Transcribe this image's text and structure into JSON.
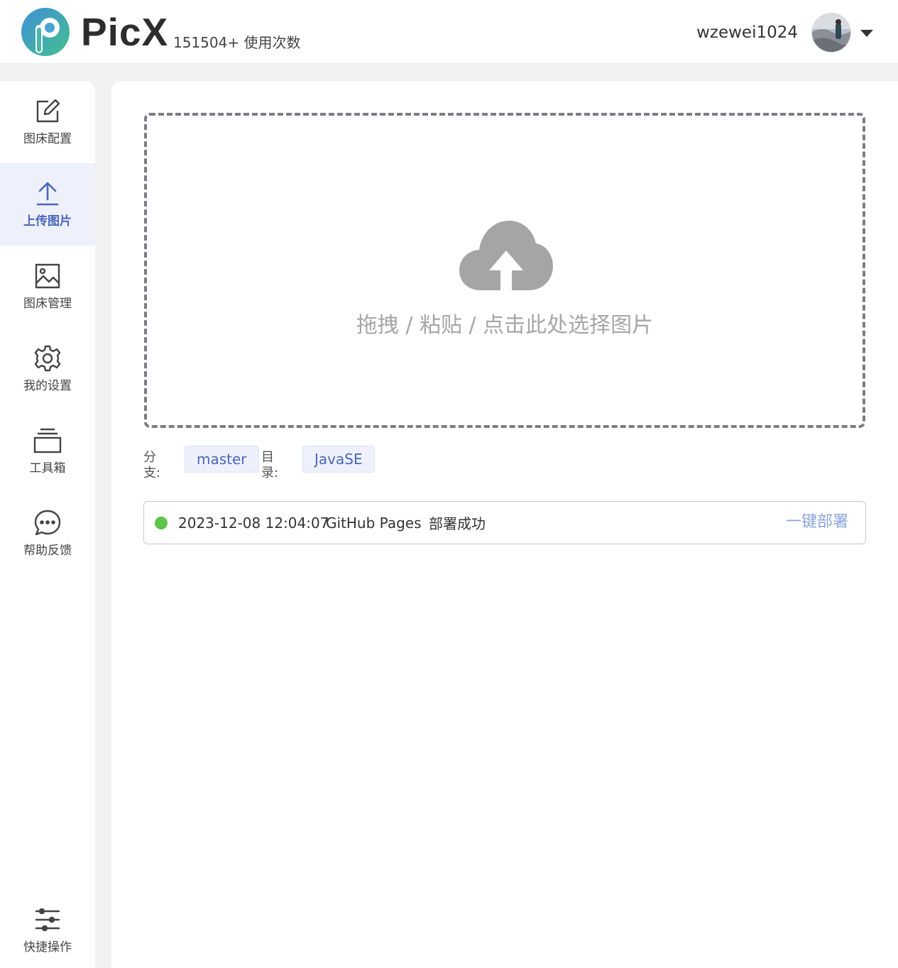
{
  "header": {
    "brand": "PicX",
    "usage": "151504+ 使用次数",
    "username": "wzewei1024",
    "logo_icon": "picx-logo-icon",
    "dropdown_icon": "caret-down-icon"
  },
  "sidebar": {
    "items": [
      {
        "label": "图床配置",
        "icon": "edit-icon"
      },
      {
        "label": "上传图片",
        "icon": "upload-icon",
        "active": true
      },
      {
        "label": "图床管理",
        "icon": "image-icon"
      },
      {
        "label": "我的设置",
        "icon": "gear-icon"
      },
      {
        "label": "工具箱",
        "icon": "toolbox-icon"
      },
      {
        "label": "帮助反馈",
        "icon": "chat-icon"
      },
      {
        "label": "快捷操作",
        "icon": "sliders-icon"
      }
    ]
  },
  "main": {
    "dropzone": {
      "hint": "拖拽 / 粘贴 / 点击此处选择图片",
      "icon": "cloud-upload-icon"
    },
    "branch_label": "分支:",
    "branch_value": "master",
    "dir_label": "目录:",
    "dir_value": "JavaSE",
    "deploy": {
      "time": "2023-12-08 12:04:07",
      "service": "GitHub Pages",
      "status": "部署成功",
      "button": "一键部署",
      "status_color": "#5fc24a"
    }
  },
  "colors": {
    "accent": "#4a67b8",
    "active_bg": "#eef0fb",
    "deploy_link": "#8aa3dc"
  }
}
